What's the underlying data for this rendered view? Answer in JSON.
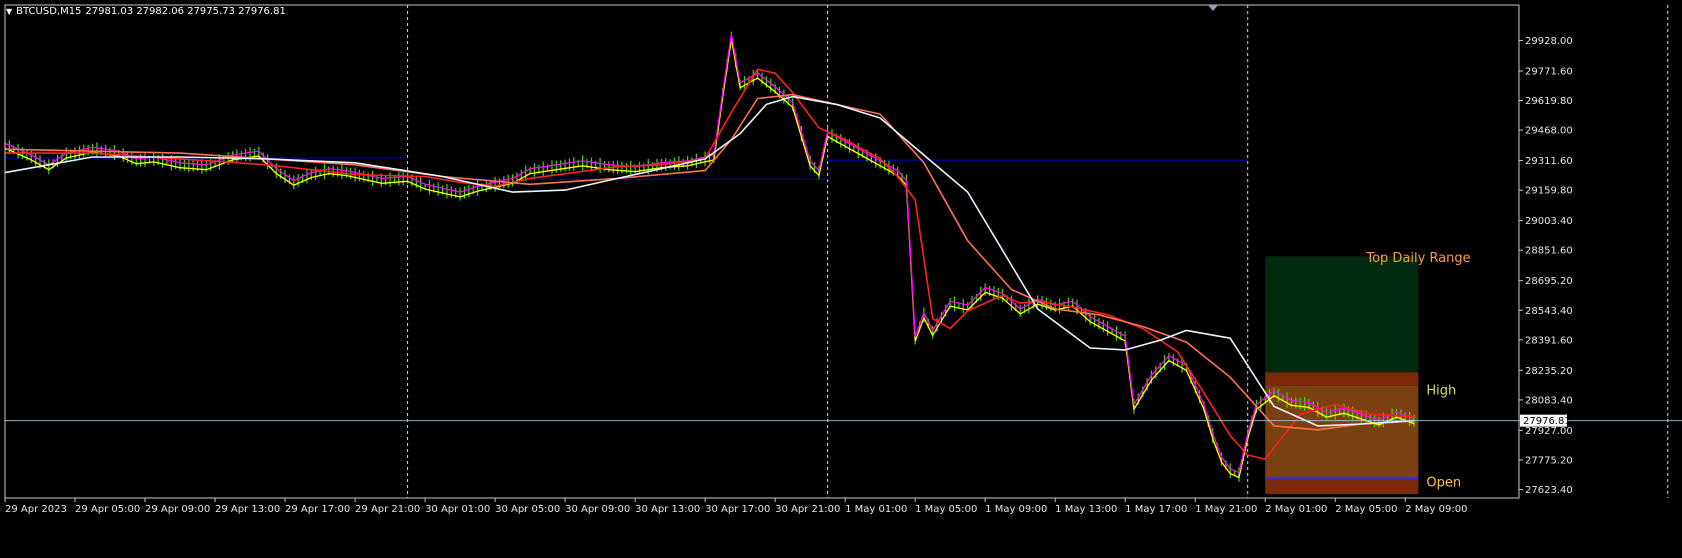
{
  "header": {
    "menu_icon": "triangle-down-icon",
    "symbol": "BTCUSD,M15",
    "ohlc": "27981.03 27982.06 27975.73 27976.81"
  },
  "colors": {
    "background": "#000000",
    "frame": "#c8c8c8",
    "price_bars": "#3cdc00",
    "ma_fast": "#ffff00",
    "ma_mid": "#ff00ff",
    "ma_red": "#ff2020",
    "ma_white": "#e8f4ff",
    "ma_orange": "#ff7050",
    "level_line": "#0000c8",
    "top_zone": "#002a10",
    "mid_zone": "#7a4010",
    "band_zone": "#7a2a08",
    "label_top": "#ff9a40",
    "label_high": "#cce050",
    "label_open": "#ffc040"
  },
  "chart_data": {
    "type": "line",
    "title": "BTCUSD,M15",
    "ohlc_readout": {
      "open": 27981.03,
      "high": 27982.06,
      "low": 27975.73,
      "close": 27976.81
    },
    "current_price": "27976.81",
    "ylim": [
      27580,
      30110
    ],
    "grid": "vertical dashed day separators",
    "y_ticks": [
      "29928.00",
      "29771.60",
      "29619.80",
      "29468.00",
      "29311.60",
      "29159.80",
      "29003.40",
      "28851.60",
      "28695.20",
      "28543.40",
      "28391.60",
      "28235.20",
      "28083.40",
      "27927.00",
      "27775.20",
      "27623.40"
    ],
    "x_ticks": [
      "29 Apr 2023",
      "29 Apr 05:00",
      "29 Apr 09:00",
      "29 Apr 13:00",
      "29 Apr 17:00",
      "29 Apr 21:00",
      "30 Apr 01:00",
      "30 Apr 05:00",
      "30 Apr 09:00",
      "30 Apr 13:00",
      "30 Apr 17:00",
      "30 Apr 21:00",
      "1 May 01:00",
      "1 May 05:00",
      "1 May 09:00",
      "1 May 13:00",
      "1 May 17:00",
      "1 May 21:00",
      "2 May 01:00",
      "2 May 05:00",
      "2 May 09:00"
    ],
    "x_tick_index": [
      0,
      16,
      32,
      48,
      64,
      80,
      96,
      112,
      128,
      144,
      160,
      176,
      192,
      208,
      224,
      240,
      256,
      272,
      288,
      304,
      320
    ],
    "day_separator_index": [
      92,
      188,
      284,
      380
    ],
    "price_series": {
      "name": "BTCUSD",
      "x_index": [
        0,
        6,
        10,
        14,
        20,
        26,
        30,
        34,
        40,
        46,
        52,
        58,
        62,
        66,
        70,
        74,
        78,
        82,
        86,
        92,
        96,
        100,
        104,
        108,
        112,
        116,
        120,
        126,
        132,
        138,
        144,
        150,
        156,
        162,
        164,
        166,
        168,
        172,
        176,
        180,
        184,
        186,
        188,
        192,
        196,
        200,
        204,
        206,
        208,
        210,
        212,
        216,
        220,
        224,
        228,
        232,
        236,
        240,
        244,
        248,
        252,
        256,
        258,
        262,
        266,
        270,
        274,
        276,
        278,
        280,
        282,
        284,
        286,
        290,
        294,
        298,
        302,
        306,
        310,
        314,
        318,
        322
      ],
      "y": [
        29390,
        29330,
        29280,
        29340,
        29370,
        29350,
        29310,
        29320,
        29290,
        29280,
        29330,
        29350,
        29260,
        29200,
        29240,
        29260,
        29250,
        29230,
        29210,
        29220,
        29180,
        29160,
        29140,
        29170,
        29190,
        29210,
        29260,
        29280,
        29300,
        29280,
        29270,
        29290,
        29300,
        29330,
        29650,
        29950,
        29700,
        29750,
        29680,
        29600,
        29300,
        29250,
        29450,
        29400,
        29350,
        29300,
        29250,
        29200,
        28400,
        28520,
        28430,
        28580,
        28560,
        28650,
        28620,
        28540,
        28590,
        28560,
        28580,
        28500,
        28450,
        28400,
        28050,
        28200,
        28300,
        28250,
        28050,
        27900,
        27780,
        27720,
        27700,
        27900,
        28050,
        28120,
        28070,
        28060,
        28010,
        28030,
        28000,
        27970,
        28010,
        27977
      ]
    },
    "ma_series": [
      {
        "name": "MA red",
        "x_index": [
          0,
          20,
          40,
          60,
          80,
          96,
          104,
          112,
          120,
          140,
          150,
          160,
          166,
          172,
          176,
          180,
          186,
          192,
          196,
          200,
          204,
          208,
          212,
          216,
          220,
          228,
          232,
          236,
          244,
          252,
          260,
          268,
          274,
          280,
          284,
          288,
          296,
          304,
          312,
          320,
          322
        ],
        "y": [
          29350,
          29350,
          29320,
          29290,
          29240,
          29230,
          29200,
          29180,
          29220,
          29280,
          29290,
          29320,
          29560,
          29780,
          29760,
          29660,
          29480,
          29420,
          29370,
          29320,
          29230,
          29110,
          28500,
          28450,
          28540,
          28620,
          28580,
          28590,
          28560,
          28520,
          28450,
          28330,
          28120,
          27900,
          27800,
          27780,
          28010,
          28060,
          28010,
          28000,
          28000
        ]
      },
      {
        "name": "MA orange",
        "x_index": [
          0,
          40,
          80,
          100,
          120,
          140,
          160,
          166,
          172,
          180,
          190,
          200,
          210,
          220,
          230,
          240,
          250,
          260,
          270,
          280,
          290,
          300,
          310,
          322
        ],
        "y": [
          29370,
          29350,
          29290,
          29230,
          29190,
          29220,
          29260,
          29420,
          29630,
          29650,
          29600,
          29550,
          29300,
          28900,
          28650,
          28550,
          28520,
          28460,
          28380,
          28200,
          27950,
          27930,
          27960,
          27975
        ]
      },
      {
        "name": "MA white",
        "x_index": [
          0,
          20,
          40,
          60,
          80,
          100,
          116,
          128,
          140,
          152,
          160,
          168,
          174,
          180,
          190,
          200,
          220,
          236,
          248,
          256,
          264,
          270,
          280,
          290,
          300,
          310,
          322
        ],
        "y": [
          29250,
          29330,
          29330,
          29320,
          29300,
          29230,
          29150,
          29160,
          29220,
          29280,
          29320,
          29450,
          29600,
          29640,
          29600,
          29530,
          29150,
          28550,
          28350,
          28340,
          28390,
          28440,
          28400,
          28050,
          27950,
          27960,
          27977
        ]
      }
    ],
    "level_lines": [
      {
        "name": "level 1",
        "x_index": [
          0,
          91
        ],
        "y": 29325
      },
      {
        "name": "level 2",
        "x_index": [
          96,
          188
        ],
        "y": 29216
      },
      {
        "name": "level 3",
        "x_index": [
          188,
          284
        ],
        "y": 29314
      },
      {
        "name": "open line",
        "x_index": [
          288,
          323
        ],
        "y": 27684
      }
    ],
    "daily_range": {
      "start_index": 288,
      "end_index": 323,
      "top_daily_range": 28820,
      "high": 28225,
      "high_zone_top": 28155,
      "open_band": 27684,
      "bottom": 27600
    },
    "annotations": [
      {
        "name": "top-daily-range",
        "text": "Top Daily Range",
        "value": 28790
      },
      {
        "name": "high",
        "text": "High",
        "value": 28110
      },
      {
        "name": "open",
        "text": "Open",
        "value": 27640
      }
    ]
  }
}
